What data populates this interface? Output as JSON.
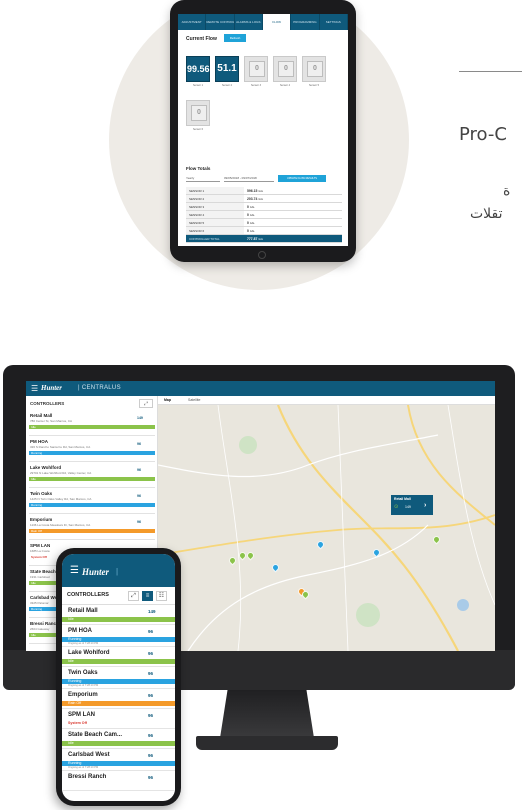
{
  "right_text": {
    "line1": "Pro-C",
    "line2": "ة",
    "line3": "تقلات"
  },
  "tablet": {
    "tabs": [
      "ADJUSTMENT",
      "REMOTE CONTROL",
      "ALARMS & LOGS",
      "FLOW",
      "PROGRAMMING",
      "SETTINGS"
    ],
    "active_tab": "FLOW",
    "current_flow_title": "Current Flow",
    "refresh_label": "Refresh",
    "sensors": [
      {
        "value": "99.56",
        "label": "Sensor 1",
        "on": true
      },
      {
        "value": "51.1",
        "label": "Sensor 2",
        "on": true
      },
      {
        "value": "0",
        "label": "Sensor 3",
        "on": false
      },
      {
        "value": "0",
        "label": "Sensor 4",
        "on": false
      },
      {
        "value": "0",
        "label": "Sensor 5",
        "on": false
      },
      {
        "value": "0",
        "label": "Sensor 6",
        "on": false
      }
    ],
    "flow_totals_title": "Flow Totals",
    "period_label": "Yearly",
    "date_range": "09/05/2018 - 09/07/2018",
    "update_button": "UPDATE FLOW RESULTS",
    "totals": [
      {
        "name": "SENSOR 1",
        "value": "596.15",
        "unit": "GAL"
      },
      {
        "name": "SENSOR 2",
        "value": "203.74",
        "unit": "GAL"
      },
      {
        "name": "SENSOR 3",
        "value": "0",
        "unit": "GAL"
      },
      {
        "name": "SENSOR 4",
        "value": "0",
        "unit": "GAL"
      },
      {
        "name": "SENSOR 5",
        "value": "0",
        "unit": "GAL"
      },
      {
        "name": "SENSOR 6",
        "value": "0",
        "unit": "GAL"
      }
    ],
    "grand_total": {
      "name": "CONTROLLER TOTAL",
      "value": "777.87",
      "unit": "GAL"
    }
  },
  "desktop": {
    "brand": "Hunter",
    "product": "CENTRALUS",
    "sidebar_title": "CONTROLLERS",
    "map_tabs": [
      "Map",
      "Satellite"
    ],
    "controllers": [
      {
        "name": "Retail Mall",
        "addr": "780 Center St, San Marcos, CA",
        "flow": "149",
        "status": "Idle",
        "color": "green"
      },
      {
        "name": "PM HOA",
        "addr": "326 S Rancho Santa Fe Rd, San Marcos, CA",
        "flow": "96",
        "status": "Running",
        "color": "blue"
      },
      {
        "name": "Lake Wohlford",
        "addr": "29701 N Lake Wohlford Rd, Valley Center, CA",
        "flow": "96",
        "status": "Idle",
        "color": "green"
      },
      {
        "name": "Twin Oaks",
        "addr": "1425 N Twin Oaks Valley Rd, San Marcos, CA",
        "flow": "96",
        "status": "Running",
        "color": "blue"
      },
      {
        "name": "Emporium",
        "addr": "1136 La Costa Meadows Dr, San Marcos, CA",
        "flow": "96",
        "status": "Rain Off",
        "color": "orange"
      },
      {
        "name": "SPM LAN",
        "addr": "1685 La Costa",
        "flow": "",
        "status": "System Off",
        "color": "red"
      },
      {
        "name": "State Beach",
        "addr": "1931 Carlsbad",
        "flow": "",
        "status": "Idle",
        "color": "green"
      },
      {
        "name": "Carlsbad West",
        "addr": "3325 Palomar",
        "flow": "",
        "status": "Running",
        "color": "blue"
      },
      {
        "name": "Bressi Ranch",
        "addr": "2604 Gateway",
        "flow": "",
        "status": "Idle",
        "color": "green"
      }
    ],
    "popup": {
      "title": "Retail Mall",
      "flow": "149"
    }
  },
  "phone": {
    "brand": "Hunter",
    "title": "CONTROLLERS",
    "items": [
      {
        "name": "Retail Mall",
        "flow": "149",
        "status": "Idle",
        "color": "green",
        "note": ""
      },
      {
        "name": "PM HOA",
        "flow": "96",
        "status": "Running",
        "color": "blue",
        "note": "Ongoing as of 7:28:10 PM"
      },
      {
        "name": "Lake Wohlford",
        "flow": "96",
        "status": "Idle",
        "color": "green",
        "note": ""
      },
      {
        "name": "Twin Oaks",
        "flow": "96",
        "status": "Running",
        "color": "blue",
        "note": "Ongoing as of 7:28:10 PM"
      },
      {
        "name": "Emporium",
        "flow": "96",
        "status": "Rain Off",
        "color": "orange",
        "note": ""
      },
      {
        "name": "SPM LAN",
        "flow": "96",
        "status": "System Off",
        "color": "red",
        "note": ""
      },
      {
        "name": "State Beach Cam...",
        "flow": "96",
        "status": "Idle",
        "color": "green",
        "note": ""
      },
      {
        "name": "Carlsbad West",
        "flow": "96",
        "status": "Running",
        "color": "blue",
        "note": "Ongoing as of 7:28:10 PM"
      },
      {
        "name": "Bressi Ranch",
        "flow": "96",
        "status": "",
        "color": "green",
        "note": ""
      }
    ]
  },
  "colors": {
    "brand_blue": "#0f5a7c",
    "status_green": "#8bc34a",
    "status_blue": "#2aa3e0",
    "status_orange": "#f49a2a",
    "status_red": "#d8382f"
  }
}
